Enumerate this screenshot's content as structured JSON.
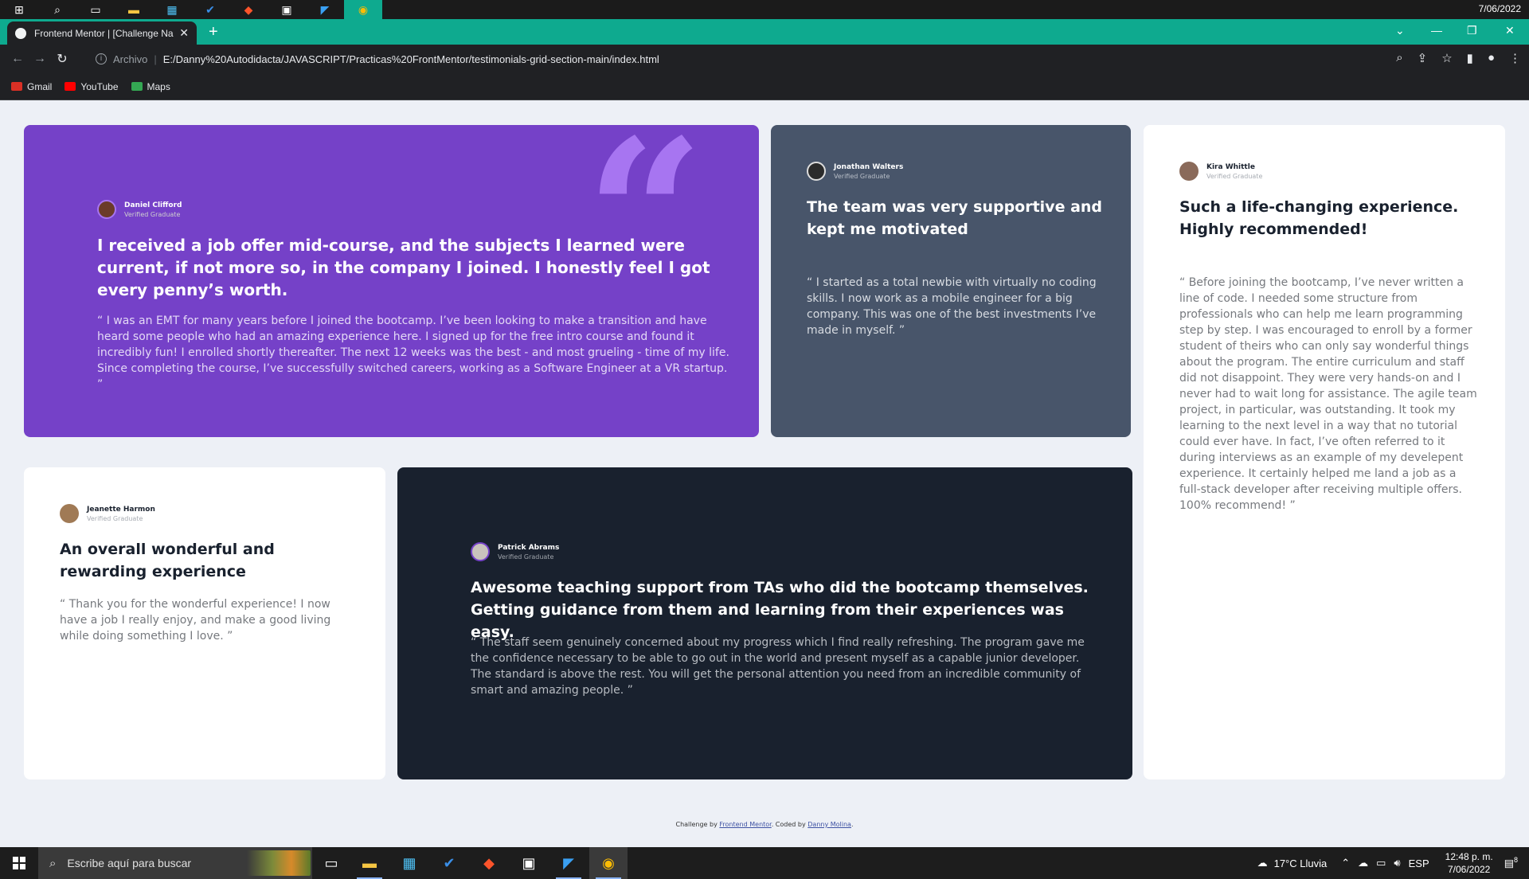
{
  "top_strip": {
    "date": "7/06/2022"
  },
  "browser": {
    "tab_title": "Frontend Mentor | [Challenge Na",
    "address": {
      "scheme_label": "Archivo",
      "url": "E:/Danny%20Autodidacta/JAVASCRIPT/Practicas%20FrontMentor/testimonials-grid-section-main/index.html"
    },
    "bookmarks": [
      {
        "label": "Gmail",
        "color": "#d93025"
      },
      {
        "label": "YouTube",
        "color": "#ff0000"
      },
      {
        "label": "Maps",
        "color": "#34a853"
      }
    ]
  },
  "testimonials": [
    {
      "name": "Daniel Clifford",
      "status": "Verified Graduate",
      "headline": "I received a job offer mid-course, and the subjects I learned were current, if not more so, in the company I joined. I honestly feel I got every penny’s worth.",
      "quote": "“ I was an EMT for many years before I joined the bootcamp. I’ve been looking to make a transition and have heard some people who had an amazing experience here. I signed up for the free intro course and found it incredibly fun! I enrolled shortly thereafter. The next 12 weeks was the best - and most grueling - time of my life. Since completing the course, I’ve successfully switched careers, working as a Software Engineer at a VR startup. ”",
      "avatar_color": "#6b3b2a"
    },
    {
      "name": "Jonathan Walters",
      "status": "Verified Graduate",
      "headline": "The team was very supportive and kept me motivated",
      "quote": "“ I started as a total newbie with virtually no coding skills. I now work as a mobile engineer for a big company. This was one of the best investments I’ve made in myself. ”",
      "avatar_color": "#2b2b2b"
    },
    {
      "name": "Kira Whittle",
      "status": "Verified Graduate",
      "headline": "Such a life-changing experience. Highly recommended!",
      "quote": "“ Before joining the bootcamp, I’ve never written a line of code. I needed some structure from professionals who can help me learn programming step by step. I was encouraged to enroll by a former student of theirs who can only say wonderful things about the program. The entire curriculum and staff did not disappoint. They were very hands-on and I never had to wait long for assistance. The agile team project, in particular, was outstanding. It took my learning to the next level in a way that no tutorial could ever have. In fact, I’ve often referred to it during interviews as an example of my develepent experience. It certainly helped me land a job as a full-stack developer after receiving multiple offers. 100% recommend! ”",
      "avatar_color": "#8a6a5a"
    },
    {
      "name": "Jeanette Harmon",
      "status": "Verified Graduate",
      "headline": "An overall wonderful and rewarding experience",
      "quote": "“ Thank you for the wonderful experience! I now have a job I really enjoy, and make a good living while doing something I love. ”",
      "avatar_color": "#a07a55"
    },
    {
      "name": "Patrick Abrams",
      "status": "Verified Graduate",
      "headline": "Awesome teaching support from TAs who did the bootcamp themselves. Getting guidance from them and learning from their experiences was easy.",
      "quote": "“ The staff seem genuinely concerned about my progress which I find really refreshing. The program gave me the confidence necessary to be able to go out in the world and present myself as a capable junior developer. The standard is above the rest. You will get the personal attention you need from an incredible community of smart and amazing people. ”",
      "avatar_color": "#c9c3bd"
    }
  ],
  "attribution": {
    "prefix": "Challenge by",
    "link1": "Frontend Mentor",
    "middle": ". Coded by",
    "link2": "Danny Molina",
    "suffix": "."
  },
  "taskbar": {
    "search_placeholder": "Escribe aquí para buscar",
    "weather": "17°C  Lluvia",
    "language": "ESP",
    "time": "12:48 p. m.",
    "date": "7/06/2022",
    "notification_count": "8"
  }
}
